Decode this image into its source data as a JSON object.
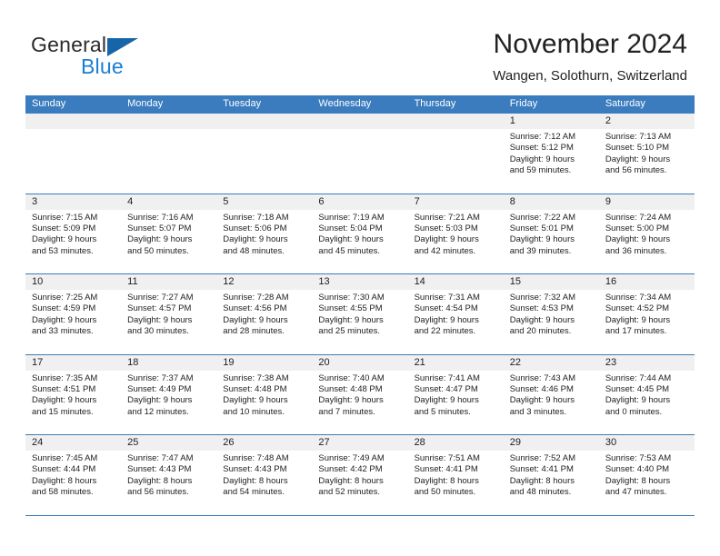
{
  "brand": {
    "name_part1": "General",
    "name_part2": "Blue",
    "accent_color": "#1565a8",
    "blue_text_color": "#1a7fd4"
  },
  "header": {
    "title": "November 2024",
    "subtitle": "Wangen, Solothurn, Switzerland"
  },
  "calendar": {
    "header_bg": "#3a7cbe",
    "daynum_bg": "#f0f0f0",
    "weekdays": [
      "Sunday",
      "Monday",
      "Tuesday",
      "Wednesday",
      "Thursday",
      "Friday",
      "Saturday"
    ],
    "weeks": [
      [
        {
          "day": "",
          "sunrise": "",
          "sunset": "",
          "daylight_line1": "",
          "daylight_line2": ""
        },
        {
          "day": "",
          "sunrise": "",
          "sunset": "",
          "daylight_line1": "",
          "daylight_line2": ""
        },
        {
          "day": "",
          "sunrise": "",
          "sunset": "",
          "daylight_line1": "",
          "daylight_line2": ""
        },
        {
          "day": "",
          "sunrise": "",
          "sunset": "",
          "daylight_line1": "",
          "daylight_line2": ""
        },
        {
          "day": "",
          "sunrise": "",
          "sunset": "",
          "daylight_line1": "",
          "daylight_line2": ""
        },
        {
          "day": "1",
          "sunrise": "Sunrise: 7:12 AM",
          "sunset": "Sunset: 5:12 PM",
          "daylight_line1": "Daylight: 9 hours",
          "daylight_line2": "and 59 minutes."
        },
        {
          "day": "2",
          "sunrise": "Sunrise: 7:13 AM",
          "sunset": "Sunset: 5:10 PM",
          "daylight_line1": "Daylight: 9 hours",
          "daylight_line2": "and 56 minutes."
        }
      ],
      [
        {
          "day": "3",
          "sunrise": "Sunrise: 7:15 AM",
          "sunset": "Sunset: 5:09 PM",
          "daylight_line1": "Daylight: 9 hours",
          "daylight_line2": "and 53 minutes."
        },
        {
          "day": "4",
          "sunrise": "Sunrise: 7:16 AM",
          "sunset": "Sunset: 5:07 PM",
          "daylight_line1": "Daylight: 9 hours",
          "daylight_line2": "and 50 minutes."
        },
        {
          "day": "5",
          "sunrise": "Sunrise: 7:18 AM",
          "sunset": "Sunset: 5:06 PM",
          "daylight_line1": "Daylight: 9 hours",
          "daylight_line2": "and 48 minutes."
        },
        {
          "day": "6",
          "sunrise": "Sunrise: 7:19 AM",
          "sunset": "Sunset: 5:04 PM",
          "daylight_line1": "Daylight: 9 hours",
          "daylight_line2": "and 45 minutes."
        },
        {
          "day": "7",
          "sunrise": "Sunrise: 7:21 AM",
          "sunset": "Sunset: 5:03 PM",
          "daylight_line1": "Daylight: 9 hours",
          "daylight_line2": "and 42 minutes."
        },
        {
          "day": "8",
          "sunrise": "Sunrise: 7:22 AM",
          "sunset": "Sunset: 5:01 PM",
          "daylight_line1": "Daylight: 9 hours",
          "daylight_line2": "and 39 minutes."
        },
        {
          "day": "9",
          "sunrise": "Sunrise: 7:24 AM",
          "sunset": "Sunset: 5:00 PM",
          "daylight_line1": "Daylight: 9 hours",
          "daylight_line2": "and 36 minutes."
        }
      ],
      [
        {
          "day": "10",
          "sunrise": "Sunrise: 7:25 AM",
          "sunset": "Sunset: 4:59 PM",
          "daylight_line1": "Daylight: 9 hours",
          "daylight_line2": "and 33 minutes."
        },
        {
          "day": "11",
          "sunrise": "Sunrise: 7:27 AM",
          "sunset": "Sunset: 4:57 PM",
          "daylight_line1": "Daylight: 9 hours",
          "daylight_line2": "and 30 minutes."
        },
        {
          "day": "12",
          "sunrise": "Sunrise: 7:28 AM",
          "sunset": "Sunset: 4:56 PM",
          "daylight_line1": "Daylight: 9 hours",
          "daylight_line2": "and 28 minutes."
        },
        {
          "day": "13",
          "sunrise": "Sunrise: 7:30 AM",
          "sunset": "Sunset: 4:55 PM",
          "daylight_line1": "Daylight: 9 hours",
          "daylight_line2": "and 25 minutes."
        },
        {
          "day": "14",
          "sunrise": "Sunrise: 7:31 AM",
          "sunset": "Sunset: 4:54 PM",
          "daylight_line1": "Daylight: 9 hours",
          "daylight_line2": "and 22 minutes."
        },
        {
          "day": "15",
          "sunrise": "Sunrise: 7:32 AM",
          "sunset": "Sunset: 4:53 PM",
          "daylight_line1": "Daylight: 9 hours",
          "daylight_line2": "and 20 minutes."
        },
        {
          "day": "16",
          "sunrise": "Sunrise: 7:34 AM",
          "sunset": "Sunset: 4:52 PM",
          "daylight_line1": "Daylight: 9 hours",
          "daylight_line2": "and 17 minutes."
        }
      ],
      [
        {
          "day": "17",
          "sunrise": "Sunrise: 7:35 AM",
          "sunset": "Sunset: 4:51 PM",
          "daylight_line1": "Daylight: 9 hours",
          "daylight_line2": "and 15 minutes."
        },
        {
          "day": "18",
          "sunrise": "Sunrise: 7:37 AM",
          "sunset": "Sunset: 4:49 PM",
          "daylight_line1": "Daylight: 9 hours",
          "daylight_line2": "and 12 minutes."
        },
        {
          "day": "19",
          "sunrise": "Sunrise: 7:38 AM",
          "sunset": "Sunset: 4:48 PM",
          "daylight_line1": "Daylight: 9 hours",
          "daylight_line2": "and 10 minutes."
        },
        {
          "day": "20",
          "sunrise": "Sunrise: 7:40 AM",
          "sunset": "Sunset: 4:48 PM",
          "daylight_line1": "Daylight: 9 hours",
          "daylight_line2": "and 7 minutes."
        },
        {
          "day": "21",
          "sunrise": "Sunrise: 7:41 AM",
          "sunset": "Sunset: 4:47 PM",
          "daylight_line1": "Daylight: 9 hours",
          "daylight_line2": "and 5 minutes."
        },
        {
          "day": "22",
          "sunrise": "Sunrise: 7:43 AM",
          "sunset": "Sunset: 4:46 PM",
          "daylight_line1": "Daylight: 9 hours",
          "daylight_line2": "and 3 minutes."
        },
        {
          "day": "23",
          "sunrise": "Sunrise: 7:44 AM",
          "sunset": "Sunset: 4:45 PM",
          "daylight_line1": "Daylight: 9 hours",
          "daylight_line2": "and 0 minutes."
        }
      ],
      [
        {
          "day": "24",
          "sunrise": "Sunrise: 7:45 AM",
          "sunset": "Sunset: 4:44 PM",
          "daylight_line1": "Daylight: 8 hours",
          "daylight_line2": "and 58 minutes."
        },
        {
          "day": "25",
          "sunrise": "Sunrise: 7:47 AM",
          "sunset": "Sunset: 4:43 PM",
          "daylight_line1": "Daylight: 8 hours",
          "daylight_line2": "and 56 minutes."
        },
        {
          "day": "26",
          "sunrise": "Sunrise: 7:48 AM",
          "sunset": "Sunset: 4:43 PM",
          "daylight_line1": "Daylight: 8 hours",
          "daylight_line2": "and 54 minutes."
        },
        {
          "day": "27",
          "sunrise": "Sunrise: 7:49 AM",
          "sunset": "Sunset: 4:42 PM",
          "daylight_line1": "Daylight: 8 hours",
          "daylight_line2": "and 52 minutes."
        },
        {
          "day": "28",
          "sunrise": "Sunrise: 7:51 AM",
          "sunset": "Sunset: 4:41 PM",
          "daylight_line1": "Daylight: 8 hours",
          "daylight_line2": "and 50 minutes."
        },
        {
          "day": "29",
          "sunrise": "Sunrise: 7:52 AM",
          "sunset": "Sunset: 4:41 PM",
          "daylight_line1": "Daylight: 8 hours",
          "daylight_line2": "and 48 minutes."
        },
        {
          "day": "30",
          "sunrise": "Sunrise: 7:53 AM",
          "sunset": "Sunset: 4:40 PM",
          "daylight_line1": "Daylight: 8 hours",
          "daylight_line2": "and 47 minutes."
        }
      ]
    ]
  }
}
